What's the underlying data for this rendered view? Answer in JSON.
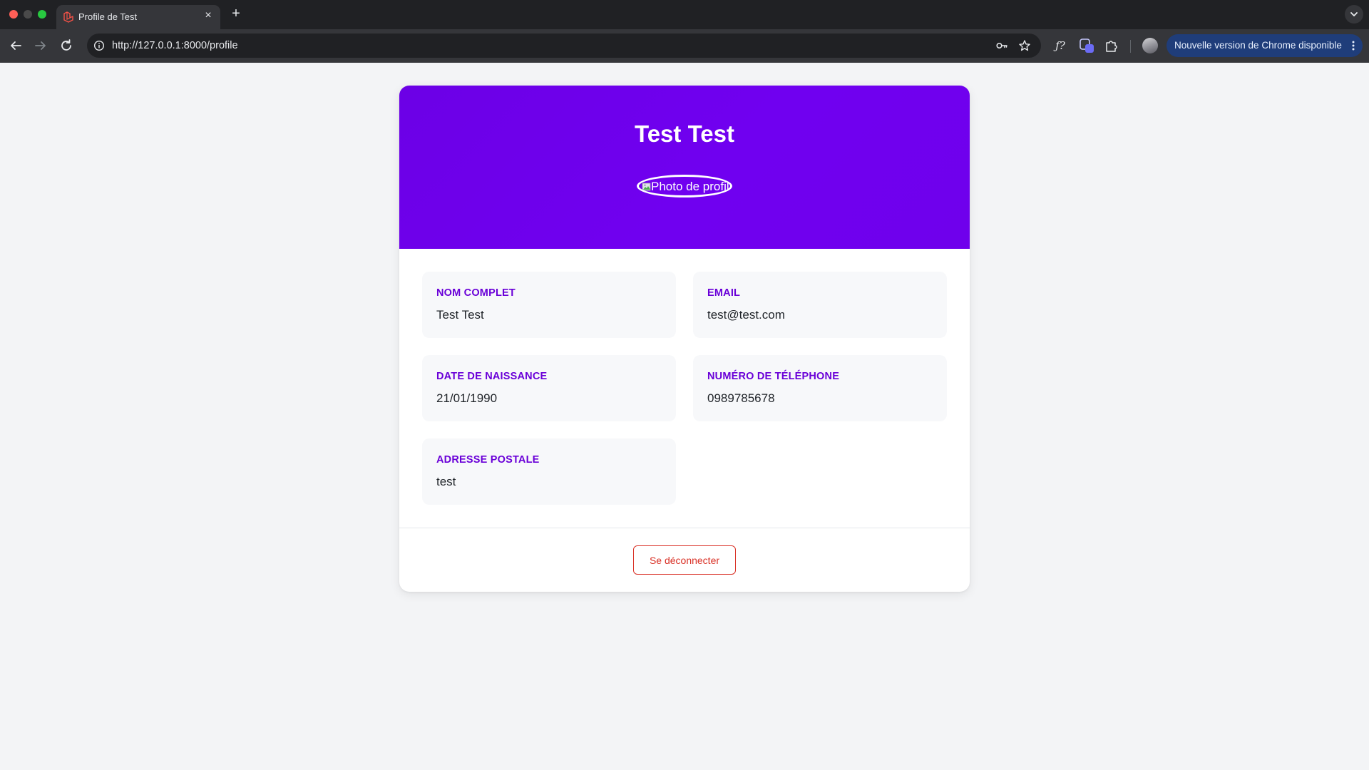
{
  "browser": {
    "tab": {
      "title": "Profile de Test",
      "favicon": "laravel-logo-icon"
    },
    "url": "http://127.0.0.1:8000/profile",
    "update_button": "Nouvelle version de Chrome disponible",
    "colors": {
      "frame": "#202124",
      "toolbar": "#35363a",
      "update_button": "#1f3d7a"
    }
  },
  "profile": {
    "name": "Test Test",
    "photo_alt": "Photo de profil",
    "fields": [
      {
        "label": "NOM COMPLET",
        "value": "Test Test"
      },
      {
        "label": "EMAIL",
        "value": "test@test.com"
      },
      {
        "label": "DATE DE NAISSANCE",
        "value": "21/01/1990"
      },
      {
        "label": "NUMÉRO DE TÉLÉPHONE",
        "value": "0989785678"
      },
      {
        "label": "ADRESSE POSTALE",
        "value": "test"
      }
    ],
    "logout_label": "Se déconnecter"
  },
  "theme": {
    "header_purple": "#6f00ec",
    "label_purple": "#6a00d8",
    "logout_red": "#d93025",
    "page_background": "#f3f4f6"
  }
}
